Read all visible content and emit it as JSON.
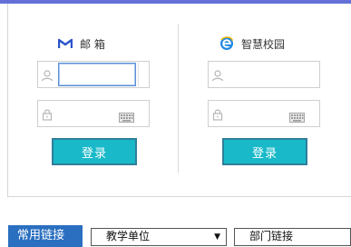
{
  "mail": {
    "title": "邮 箱",
    "username_placeholder": "",
    "password_placeholder": "",
    "login_label": "登录"
  },
  "campus": {
    "title": "智慧校园",
    "username_placeholder": "",
    "password_placeholder": "",
    "login_label": "登录"
  },
  "bottom": {
    "common_links_label": "常用链接",
    "teaching_units_label": "教学单位",
    "dept_links_label": "部门链接"
  },
  "colors": {
    "accent_bar": "#6470d8",
    "login_button": "#19b9c9",
    "links_tab": "#2a6fc0"
  },
  "icons": {
    "mail": "gmail-m-icon",
    "campus": "ie-e-icon",
    "user": "user-icon",
    "lock": "lock-icon",
    "keyboard": "keyboard-icon"
  }
}
